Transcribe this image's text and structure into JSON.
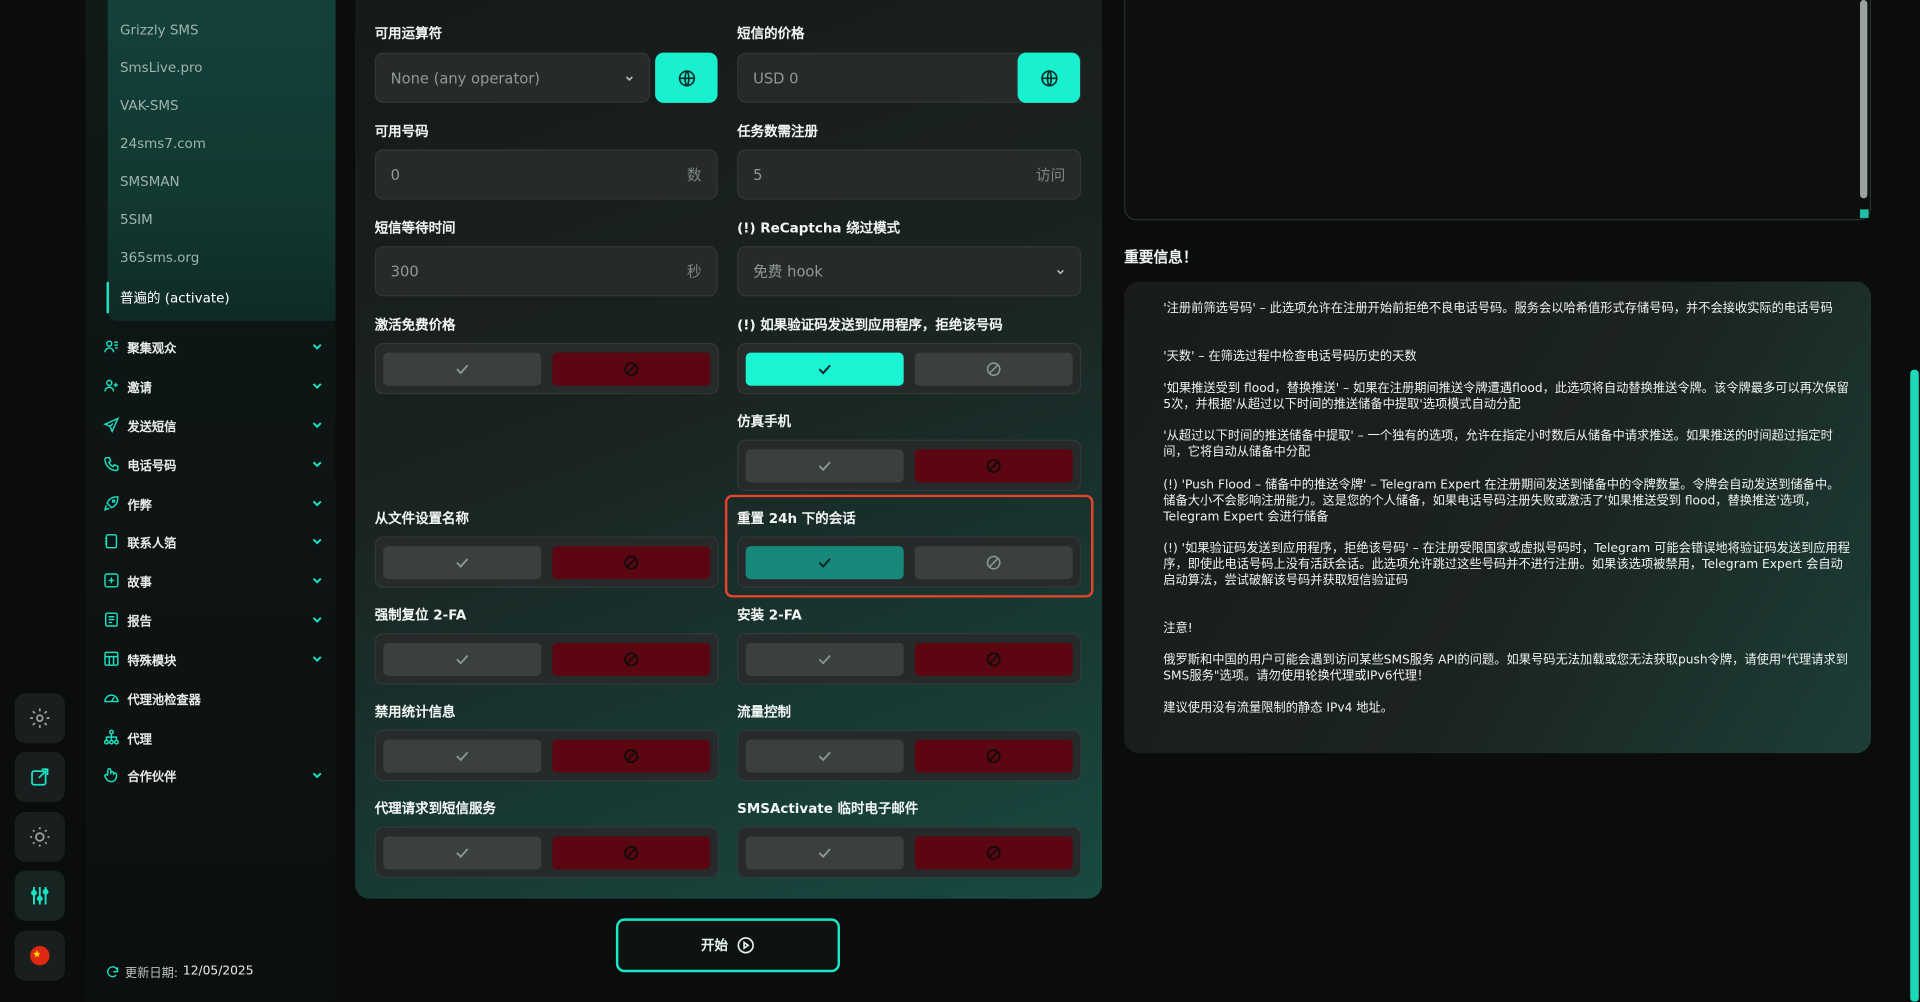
{
  "sidebar": {
    "providers": [
      "Grizzly SMS",
      "SmsLive.pro",
      "VAK-SMS",
      "24sms7.com",
      "SMSMAN",
      "5SIM",
      "365sms.org",
      "普遍的 (activate)"
    ],
    "nav": [
      {
        "label": "聚集观众",
        "icon": "users-icon",
        "chevron": true
      },
      {
        "label": "邀请",
        "icon": "user-plus-icon",
        "chevron": true
      },
      {
        "label": "发送短信",
        "icon": "send-icon",
        "chevron": true
      },
      {
        "label": "电话号码",
        "icon": "phone-icon",
        "chevron": true
      },
      {
        "label": "作弊",
        "icon": "rocket-icon",
        "chevron": true
      },
      {
        "label": "联系人箔",
        "icon": "contacts-icon",
        "chevron": true
      },
      {
        "label": "故事",
        "icon": "plus-square-icon",
        "chevron": true
      },
      {
        "label": "报告",
        "icon": "report-icon",
        "chevron": true
      },
      {
        "label": "特殊模块",
        "icon": "modules-icon",
        "chevron": true
      },
      {
        "label": "代理池检查器",
        "icon": "gauge-icon",
        "chevron": false
      },
      {
        "label": "代理",
        "icon": "network-icon",
        "chevron": false
      },
      {
        "label": "合作伙伴",
        "icon": "handshake-icon",
        "chevron": true
      }
    ],
    "updated_label": "更新日期:",
    "updated_value": "12/05/2025"
  },
  "rail": [
    "gear-icon",
    "external-link-icon",
    "sun-icon",
    "sliders-icon",
    "china-flag-icon"
  ],
  "form": {
    "operator_label": "可用运算符",
    "operator_value": "None (any operator)",
    "price_label": "短信的价格",
    "price_value": "USD  0",
    "numbers_label": "可用号码",
    "numbers_value": "0",
    "numbers_suffix": "数",
    "tasks_label": "任务数需注册",
    "tasks_value": "5",
    "tasks_suffix": "访问",
    "wait_label": "短信等待时间",
    "wait_value": "300",
    "wait_suffix": "秒",
    "recaptcha_label": "(!) ReCaptcha 绕过模式",
    "recaptcha_value": "免费 hook",
    "free_price_label": "激活免费价格",
    "reject_app_label": "(!) 如果验证码发送到应用程序，拒绝该号码",
    "emulate_label": "仿真手机",
    "file_name_label": "从文件设置名称",
    "reset24_label": "重置 24h 下的会话",
    "force2fa_label": "强制复位 2-FA",
    "install2fa_label": "安装 2-FA",
    "disable_stats_label": "禁用统计信息",
    "traffic_label": "流量控制",
    "proxy_sms_label": "代理请求到短信服务",
    "temp_email_label": "SMSActivate 临时电子邮件",
    "start_label": "开始"
  },
  "info": {
    "title": "重要信息！",
    "p1": "'注册前筛选号码' – 此选项允许在注册开始前拒绝不良电话号码。服务会以哈希值形式存储号码，并不会接收实际的电话号码",
    "p2": "'天数' – 在筛选过程中检查电话号码历史的天数",
    "p3": "'如果推送受到 flood，替换推送' – 如果在注册期间推送令牌遭遇flood，此选项将自动替换推送令牌。该令牌最多可以再次保留5次，并根据'从超过以下时间的推送储备中提取'选项模式自动分配",
    "p4": "'从超过以下时间的推送储备中提取' – 一个独有的选项，允许在指定小时数后从储备中请求推送。如果推送的时间超过指定时间，它将自动从储备中分配",
    "p5": "(!) 'Push Flood – 储备中的推送令牌' – Telegram Expert 在注册期间发送到储备中的令牌数量。令牌会自动发送到储备中。储备大小不会影响注册能力。这是您的个人储备，如果电话号码注册失败或激活了'如果推送受到 flood，替换推送'选项，Telegram Expert 会进行储备",
    "p6": "(!) '如果验证码发送到应用程序，拒绝该号码' – 在注册受限国家或虚拟号码时，Telegram 可能会错误地将验证码发送到应用程序，即使此电话号码上没有活跃会话。此选项允许跳过这些号码并不进行注册。如果该选项被禁用，Telegram Expert 会自动启动算法，尝试破解该号码并获取短信验证码",
    "p7": "注意!",
    "p8": "俄罗斯和中国的用户可能会遇到访问某些SMS服务 API的问题。如果号码无法加载或您无法获取push令牌，请使用\"代理请求到SMS服务\"选项。请勿使用轮换代理或IPv6代理！",
    "p9": "建议使用没有流量限制的静态 IPv4 地址。"
  },
  "colors": {
    "accent": "#19f0cf",
    "danger": "#5c0611",
    "panel": "#1a2321"
  }
}
